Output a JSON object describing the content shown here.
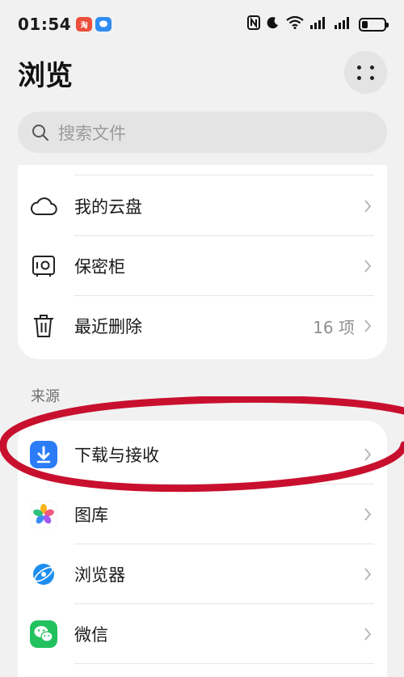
{
  "status_bar": {
    "time": "01:54",
    "notif_taobao": "淘",
    "signal_glyph": "ıll",
    "battery_level": 0.25
  },
  "header": {
    "title": "浏览"
  },
  "search": {
    "placeholder": "搜索文件"
  },
  "locations": {
    "items": [
      {
        "label": "我的云盘",
        "icon": "cloud-icon"
      },
      {
        "label": "保密柜",
        "icon": "safe-icon"
      },
      {
        "label": "最近删除",
        "icon": "trash-icon",
        "value": "16 项"
      }
    ]
  },
  "sources": {
    "section_label": "来源",
    "items": [
      {
        "label": "下载与接收",
        "icon": "download-app-icon",
        "color": "#2b7cf6"
      },
      {
        "label": "图库",
        "icon": "gallery-app-icon"
      },
      {
        "label": "浏览器",
        "icon": "browser-app-icon",
        "color": "#1b8ef0"
      },
      {
        "label": "微信",
        "icon": "wechat-app-icon",
        "color": "#22c15e"
      }
    ]
  },
  "annotation": {
    "color": "#c8102e"
  }
}
